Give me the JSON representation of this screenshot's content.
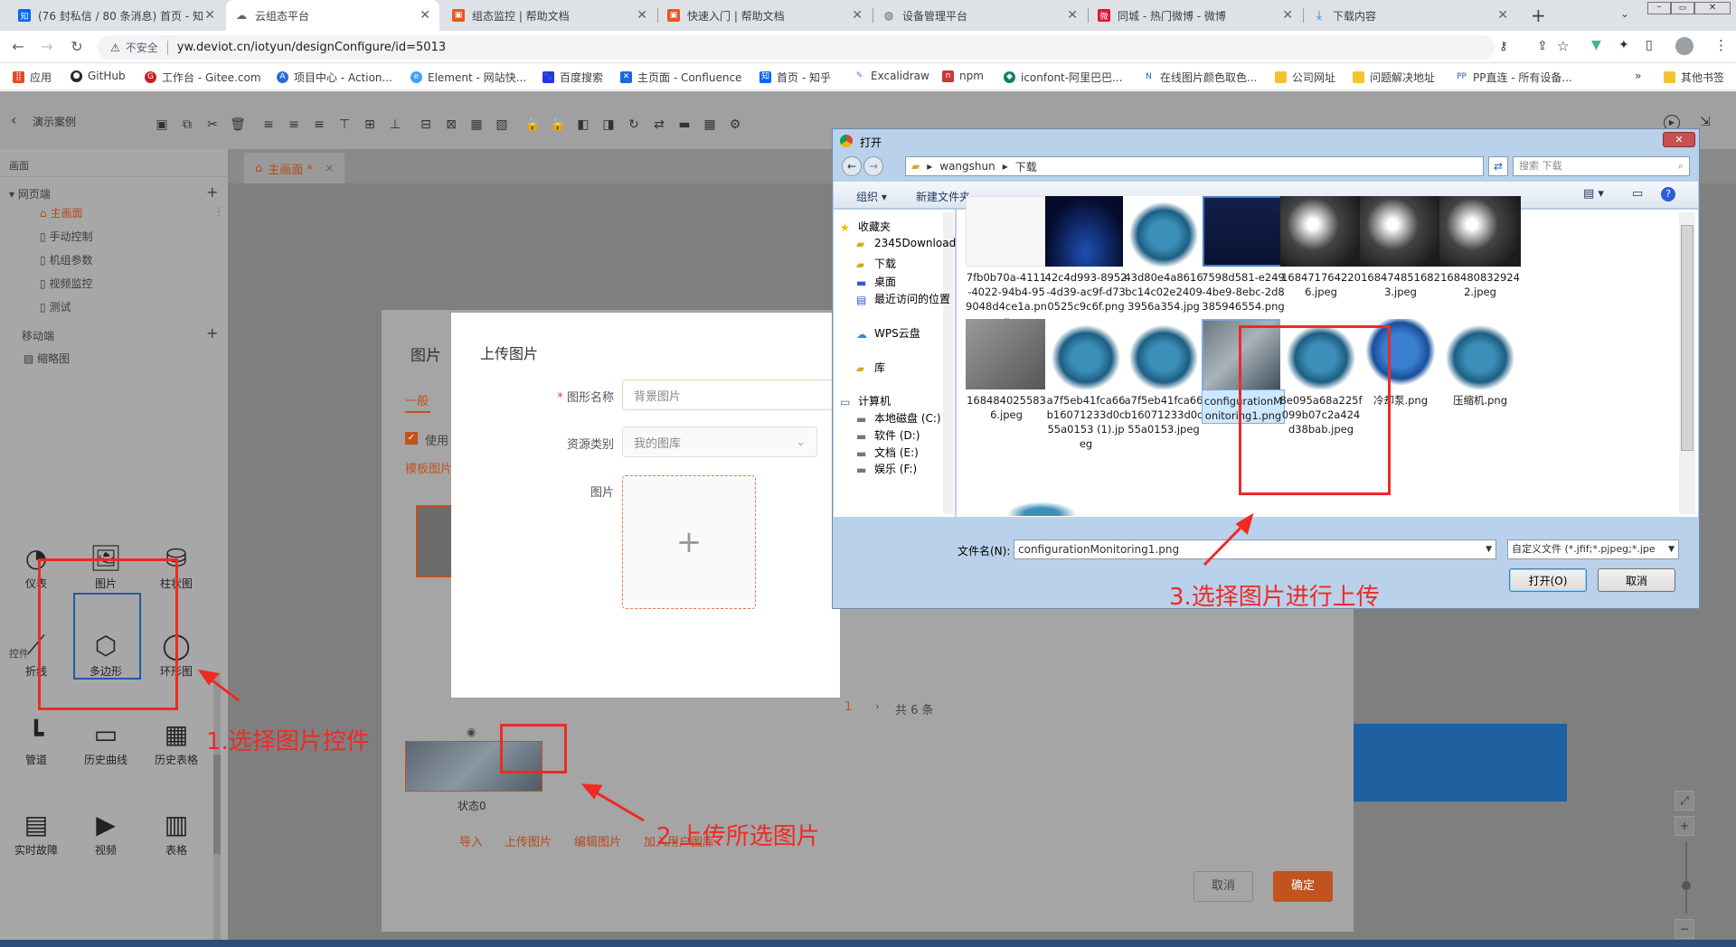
{
  "browser": {
    "tabs": [
      {
        "title": "(76 封私信 / 80 条消息) 首页 - 知",
        "icon": "zhihu-icon",
        "color": "#0066ff"
      },
      {
        "title": "云组态平台",
        "icon": "cloud-icon",
        "color": "#5f6368"
      },
      {
        "title": "组态监控 | 帮助文档",
        "icon": "docs-icon",
        "color": "#e8561f"
      },
      {
        "title": "快速入门 | 帮助文档",
        "icon": "docs-icon",
        "color": "#e8561f"
      },
      {
        "title": "设备管理平台",
        "icon": "globe-icon",
        "color": "#5f6368"
      },
      {
        "title": "同城 - 热门微博 - 微博",
        "icon": "weibo-icon",
        "color": "#e6162d"
      },
      {
        "title": "下载内容",
        "icon": "download-icon",
        "color": "#1a73e8"
      }
    ],
    "security": "不安全",
    "url": "yw.deviot.cn/iotyun/designConfigure/id=5013",
    "bookmarks": [
      "应用",
      "GitHub",
      "工作台 - Gitee.com",
      "项目中心 - Action...",
      "Element - 网站快...",
      "百度搜索",
      "主页面 - Confluence",
      "首页 - 知乎",
      "Excalidraw",
      "npm",
      "iconfont-阿里巴巴...",
      "在线图片颜色取色...",
      "公司网址",
      "问题解决地址",
      "PP直连 - 所有设备..."
    ],
    "other_bookmarks": "其他书签"
  },
  "app": {
    "back_label": "演示案例",
    "left_header": "画面",
    "web_section": "网页端",
    "pages": [
      "主画面",
      "手动控制",
      "机组参数",
      "视频监控",
      "测试"
    ],
    "mobile_section": "移动端",
    "mobile_pages": [
      "缩略图"
    ],
    "controls_header": "控件",
    "widgets": [
      {
        "label": "仪表",
        "icon": "gauge-icon"
      },
      {
        "label": "图片",
        "icon": "image-icon"
      },
      {
        "label": "柱状图",
        "icon": "cylinder-icon"
      },
      {
        "label": "折线",
        "icon": "polyline-icon"
      },
      {
        "label": "多边形",
        "icon": "hexagon-icon"
      },
      {
        "label": "环形图",
        "icon": "ring-icon"
      },
      {
        "label": "管道",
        "icon": "pipe-icon"
      },
      {
        "label": "历史曲线",
        "icon": "history-chart-icon"
      },
      {
        "label": "历史表格",
        "icon": "table-grid-icon"
      },
      {
        "label": "实时故障",
        "icon": "fault-icon"
      },
      {
        "label": "视频",
        "icon": "video-icon"
      },
      {
        "label": "表格",
        "icon": "table-icon"
      }
    ],
    "active_page_tab": "主画面 *"
  },
  "image_modal": {
    "title": "图片",
    "tab_general": "一般",
    "use_label": "使用",
    "template_label": "模板图片",
    "state_label": "状态0",
    "pagination_page": "1",
    "pagination_total": "共 6 条",
    "links": [
      "导入",
      "上传图片",
      "编辑图片",
      "加入用户图库"
    ],
    "cancel": "取消",
    "confirm": "确定"
  },
  "upload_dialog": {
    "title": "上传图片",
    "name_label": "图形名称",
    "name_value": "背景图片",
    "category_label": "资源类别",
    "category_value": "我的图库",
    "image_label": "图片",
    "plus": "+"
  },
  "file_dialog": {
    "title": "打开",
    "breadcrumb": [
      "wangshun",
      "下载"
    ],
    "search_placeholder": "搜索 下载",
    "organize": "组织 ▾",
    "new_folder": "新建文件夹",
    "nav": {
      "favorites": "收藏夹",
      "fav_items": [
        "2345Download",
        "下载",
        "桌面",
        "最近访问的位置"
      ],
      "wps": "WPS云盘",
      "library": "库",
      "computer": "计算机",
      "drives": [
        "本地磁盘 (C:)",
        "软件 (D:)",
        "文档 (E:)",
        "娱乐 (F:)"
      ]
    },
    "files": [
      {
        "name": "7fb0b70a-4111-4022-94b4-959048d4ce1a.png",
        "thumb": "blank"
      },
      {
        "name": "42c4d993-8952-4d39-ac9f-d730525c9c6f.png",
        "thumb": "dark-blue"
      },
      {
        "name": "43d80e4a8616bc14c02e24093956a354.jpg",
        "thumb": "compressor"
      },
      {
        "name": "7598d581-e249-4be9-8ebc-2d8385946554.png",
        "thumb": "navy"
      },
      {
        "name": "1684717642206.jpeg",
        "thumb": "room"
      },
      {
        "name": "1684748516823.jpeg",
        "thumb": "room"
      },
      {
        "name": "1684808329242.jpeg",
        "thumb": "room"
      },
      {
        "name": "1684840255836.jpeg",
        "thumb": "gray-room"
      },
      {
        "name": "a7f5eb41fca66b16071233d0c55a0153 (1).jpeg",
        "thumb": "compressor"
      },
      {
        "name": "a7f5eb41fca66b16071233d0c55a0153.jpeg",
        "thumb": "compressor"
      },
      {
        "name": "configurationMonitoring1.png",
        "thumb": "plant"
      },
      {
        "name": "8e095a68a225f099b07c2a424d38bab.jpeg",
        "thumb": "compressor"
      },
      {
        "name": "冷却泵.png",
        "thumb": "pump"
      },
      {
        "name": "压缩机.png",
        "thumb": "compressor"
      }
    ],
    "filename_label": "文件名(N):",
    "filename_value": "configurationMonitoring1.png",
    "filter_value": "自定义文件 (*.jfif;*.pjpeg;*.jpe",
    "open_button": "打开(O)",
    "cancel_button": "取消"
  },
  "annotations": {
    "step1": "1.选择图片控件",
    "step2": "2.上传所选图片",
    "step3": "3.选择图片进行上传"
  },
  "colors": {
    "accent": "#c0531f",
    "annotation_red": "#ee2a24",
    "canvas_blue": "#0d5aa6"
  }
}
